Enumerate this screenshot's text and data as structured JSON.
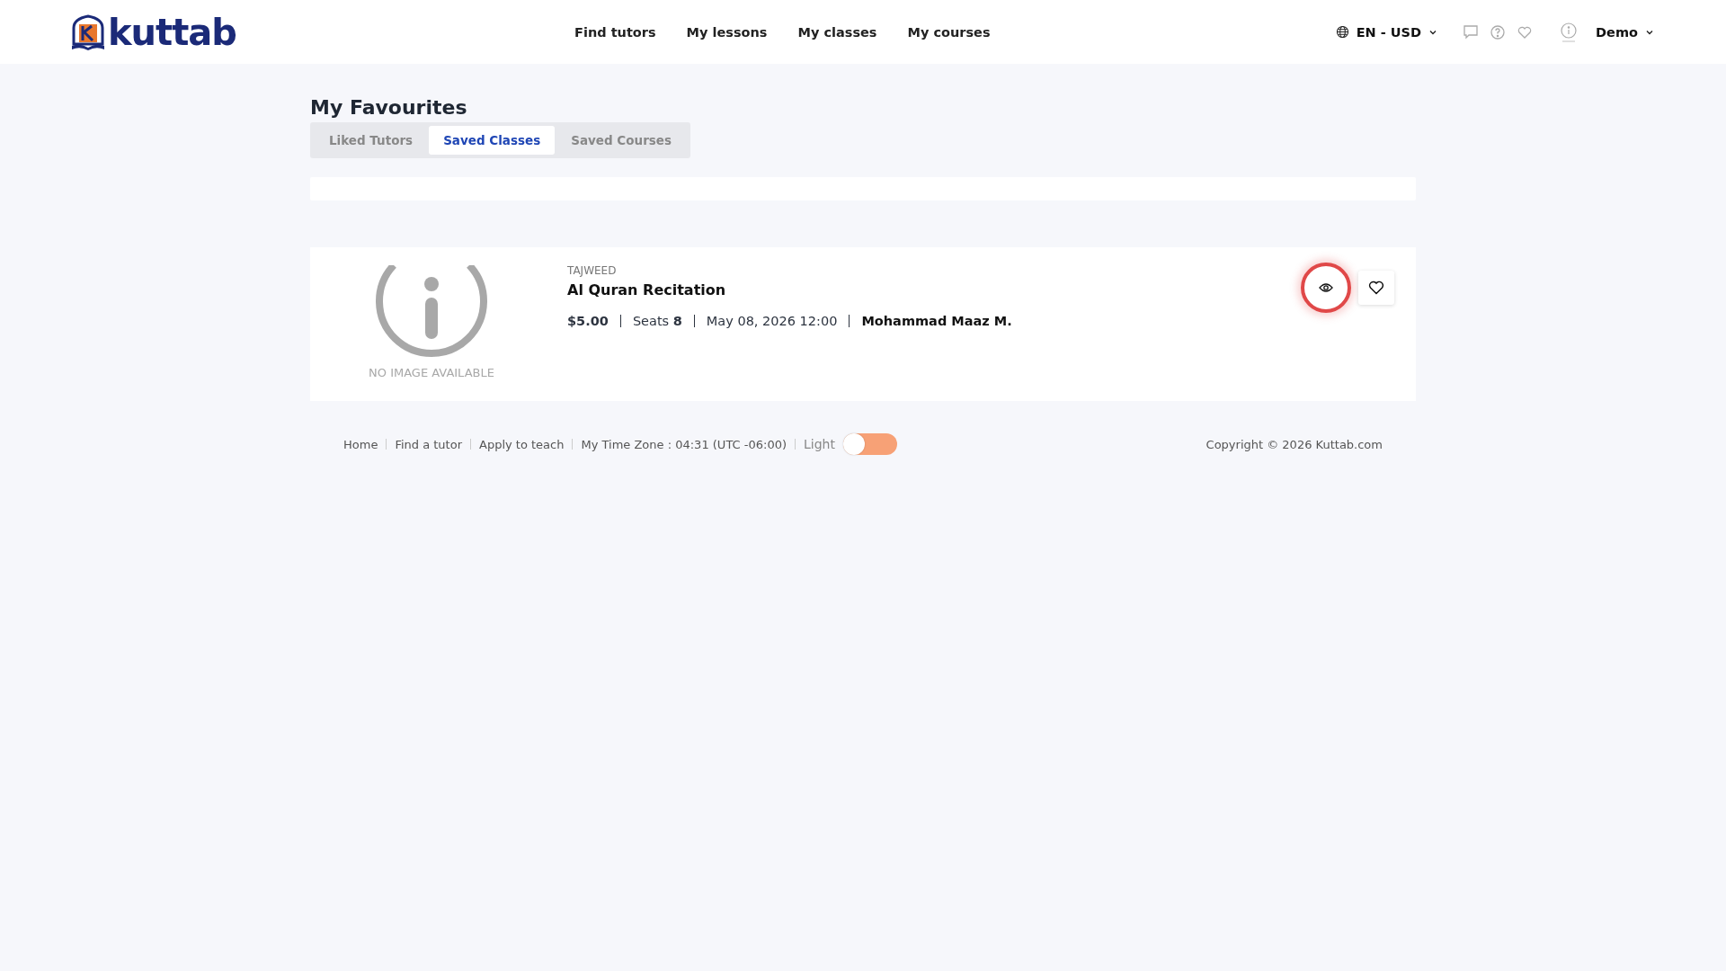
{
  "header": {
    "logo": "kuttab",
    "nav": [
      "Find tutors",
      "My lessons",
      "My classes",
      "My courses"
    ],
    "locale": "EN - USD",
    "user": "Demo"
  },
  "page": {
    "title": "My Favourites",
    "tabs": [
      {
        "label": "Liked Tutors",
        "selected": false
      },
      {
        "label": "Saved Classes",
        "selected": true
      },
      {
        "label": "Saved Courses",
        "selected": false
      }
    ]
  },
  "classes": [
    {
      "image": {
        "kind": "placeholder",
        "caption": "NO IMAGE AVAILABLE"
      },
      "category": "TAJWEED",
      "title": "Al Quran Recitation",
      "price": "$5.00",
      "seats_label": "Seats",
      "seats": "8",
      "date": "May 08, 2026 12:00",
      "tutor": "Mohammad Maaz M.",
      "view_focused": true
    }
  ],
  "footer": {
    "links": [
      "Home",
      "Find a tutor",
      "Apply to teach"
    ],
    "timezone": "My Time Zone : 04:31 (UTC -06:00)",
    "theme": {
      "label": "Light",
      "on": false
    },
    "copyright": "Copyright © 2026 Kuttab.com"
  }
}
